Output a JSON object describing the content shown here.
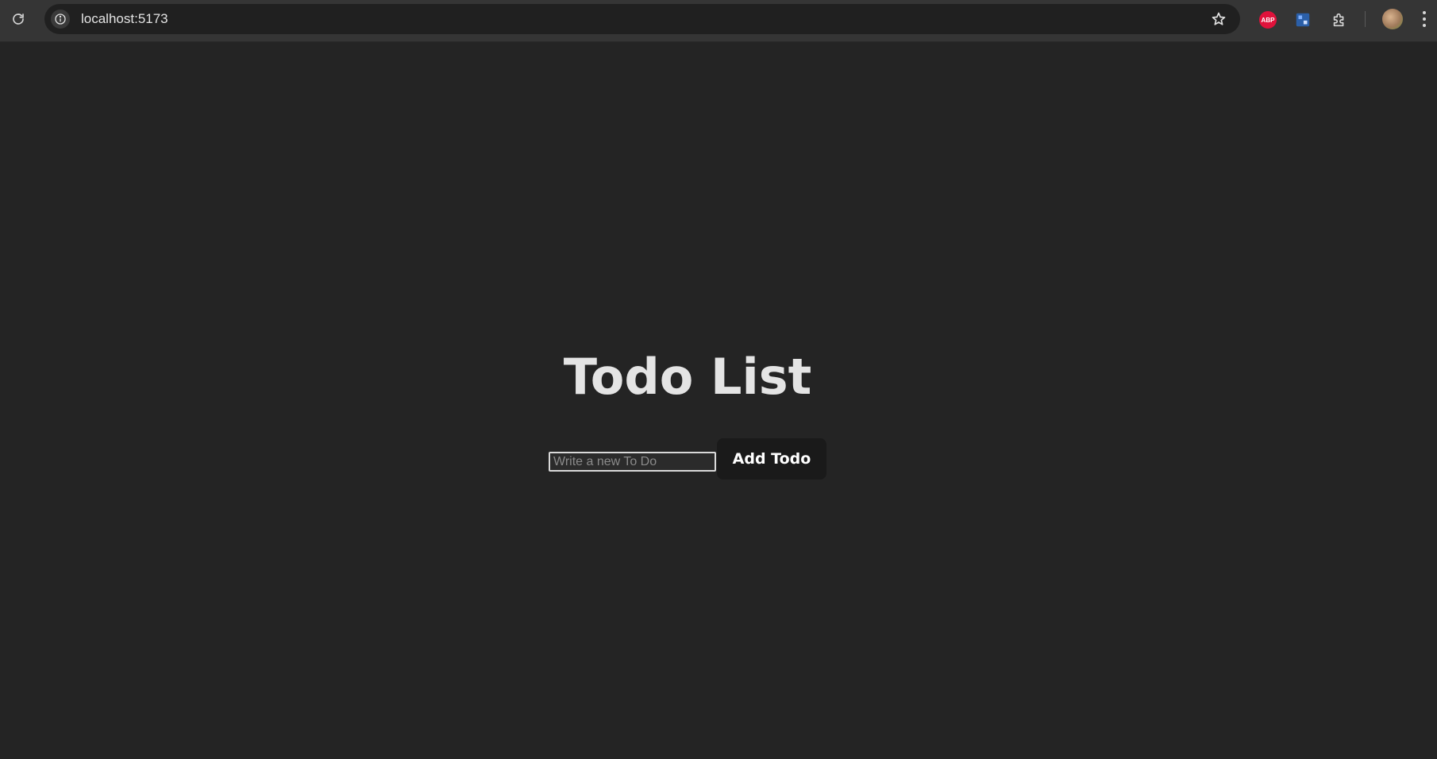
{
  "browser": {
    "url": "localhost:5173",
    "extensions": [
      "ABP"
    ]
  },
  "app": {
    "title": "Todo List",
    "input": {
      "placeholder": "Write a new To Do",
      "value": ""
    },
    "add_button_label": "Add Todo"
  },
  "colors": {
    "page_background": "#242424",
    "title_text": "#e4e4e4",
    "button_background": "#1a1a1a",
    "abp_red": "#e0123b"
  }
}
